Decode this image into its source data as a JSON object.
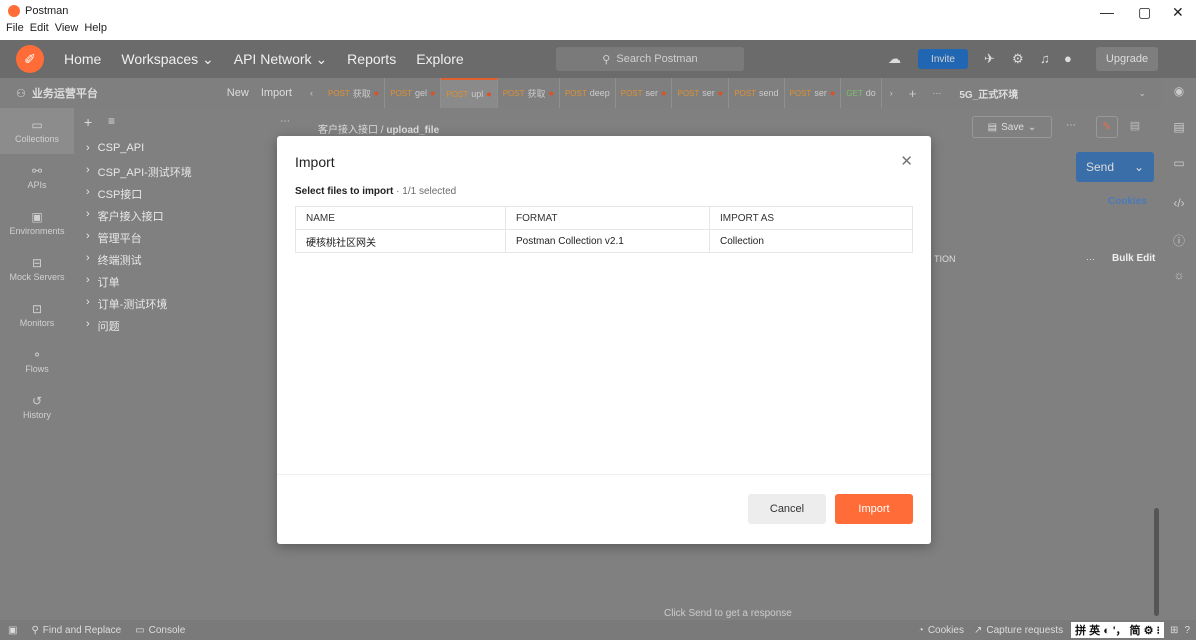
{
  "window": {
    "title": "Postman",
    "controls": [
      "—",
      "▢",
      "✕"
    ]
  },
  "menu": [
    "File",
    "Edit",
    "View",
    "Help"
  ],
  "topnav": {
    "home": "Home",
    "workspaces": "Workspaces ⌄",
    "api_network": "API Network ⌄",
    "reports": "Reports",
    "explore": "Explore",
    "search_placeholder": "Search Postman",
    "invite": "Invite",
    "upgrade": "Upgrade"
  },
  "workspace": {
    "name": "业务运营平台",
    "new_label": "New",
    "import_label": "Import"
  },
  "tabs": [
    {
      "method": "POST",
      "name": "获取"
    },
    {
      "method": "POST",
      "name": "gel"
    },
    {
      "method": "POST",
      "name": "upl"
    },
    {
      "method": "POST",
      "name": "获取"
    },
    {
      "method": "POST",
      "name": "deep"
    },
    {
      "method": "POST",
      "name": "ser"
    },
    {
      "method": "POST",
      "name": "ser"
    },
    {
      "method": "POST",
      "name": "send"
    },
    {
      "method": "POST",
      "name": "ser"
    },
    {
      "method": "GET",
      "name": "do"
    }
  ],
  "environment": "5G_正式环境",
  "left_rail": [
    "Collections",
    "APIs",
    "Environments",
    "Mock Servers",
    "Monitors",
    "Flows",
    "History"
  ],
  "collections": [
    "CSP_API",
    "CSP_API-测试环境",
    "CSP接口",
    "客户接入接口",
    "管理平台",
    "终端测试",
    "订单",
    "订单-测试环境",
    "问题"
  ],
  "breadcrumb": {
    "parent": "客户接入接口",
    "sep": "/",
    "current": "upload_file"
  },
  "request": {
    "save": "Save",
    "send": "Send",
    "cookies": "Cookies",
    "bulk_edit": "Bulk Edit",
    "desc_partial": "TION"
  },
  "response_hint": "Click Send to get a response",
  "statusbar": {
    "find_replace": "Find and Replace",
    "console": "Console",
    "cookies": "Cookies",
    "capture": "Capture requests",
    "ime": "拼 英 ◐ '， 简 ⚙ ⁝"
  },
  "modal": {
    "title": "Import",
    "subtitle": "Select files to import",
    "separator": "·",
    "count": "1/1 selected",
    "columns": [
      "NAME",
      "FORMAT",
      "IMPORT AS"
    ],
    "rows": [
      {
        "name": "硬核桃社区网关",
        "format": "Postman Collection v2.1",
        "import_as": "Collection"
      }
    ],
    "cancel": "Cancel",
    "import": "Import"
  }
}
